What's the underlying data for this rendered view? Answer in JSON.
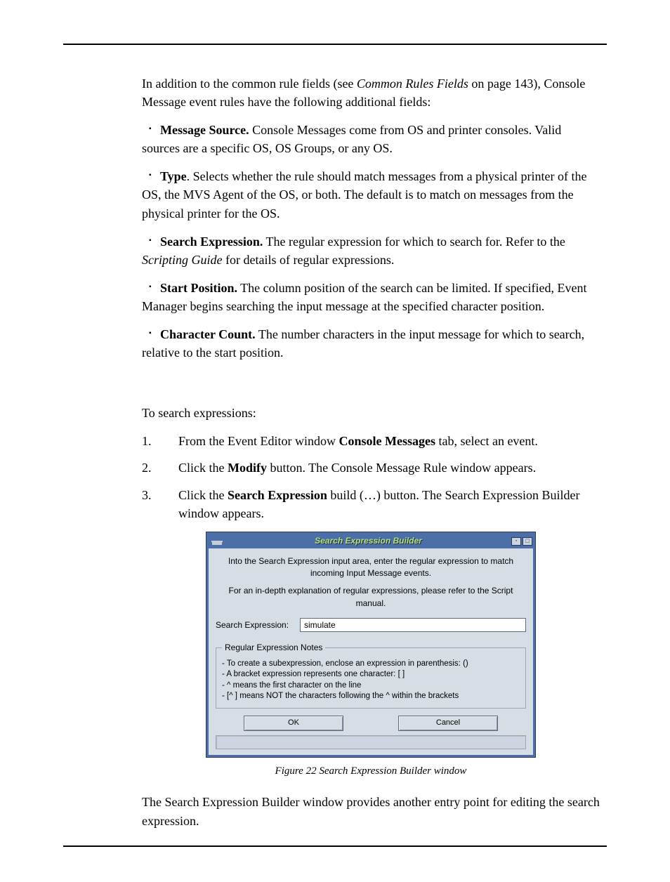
{
  "intro": {
    "prefix": "In addition to the common rule fields (see ",
    "link": "Common Rules Fields",
    "suffix": " on page 143), Console Message event rules have the following additional fields:"
  },
  "bullets": [
    {
      "label": "Message Source.",
      "text": " Console Messages come from OS and printer consoles. Valid sources are a specific OS, OS Groups, or any OS."
    },
    {
      "label": "Type",
      "text": ". Selects whether the rule should match messages from a physical printer of the OS, the MVS Agent of the OS, or both. The default is to match on messages from the physical printer for the OS."
    },
    {
      "label": "Search Expression.",
      "text": " The regular expression for which to search for. Refer to the ",
      "italic": "Scripting Guide",
      "text2": " for details of regular expressions."
    },
    {
      "label": "Start Position.",
      "text": " The column position of the search can be limited. If specified, Event Manager begins searching the input message at the specified character position."
    },
    {
      "label": "Character Count.",
      "text": " The number characters in the input message for which to search, relative to the start position."
    }
  ],
  "steps_intro": "To search expressions:",
  "steps": [
    {
      "num": "1.",
      "pre": "From the Event Editor window ",
      "bold": "Console Messages",
      "post": " tab, select an event."
    },
    {
      "num": "2.",
      "pre": "Click the ",
      "bold": "Modify",
      "post": " button. The Console Message Rule window appears."
    },
    {
      "num": "3.",
      "pre": "Click the ",
      "bold": "Search Expression",
      "post": " build (…) button. The Search Expression Builder window appears."
    }
  ],
  "dialog": {
    "title": "Search Expression Builder",
    "help1": "Into the Search Expression input area, enter the regular expression to match incoming Input Message events.",
    "help2": "For an in-depth explanation of regular expressions, please refer to the Script manual.",
    "field_label": "Search Expression:",
    "field_value": "simulate",
    "notes_legend": "Regular Expression Notes",
    "notes": [
      "- To create a subexpression, enclose an expression in parenthesis: ()",
      "- A bracket expression represents one character: [ ]",
      "- ^ means the first character on the line",
      "- [^ ] means NOT the characters following the ^ within the brackets"
    ],
    "ok": "OK",
    "cancel": "Cancel",
    "max_btn": "▫",
    "restore_btn": "□"
  },
  "caption": "Figure 22 Search Expression Builder window",
  "closing": "The Search Expression Builder window provides another entry point for editing the search expression."
}
